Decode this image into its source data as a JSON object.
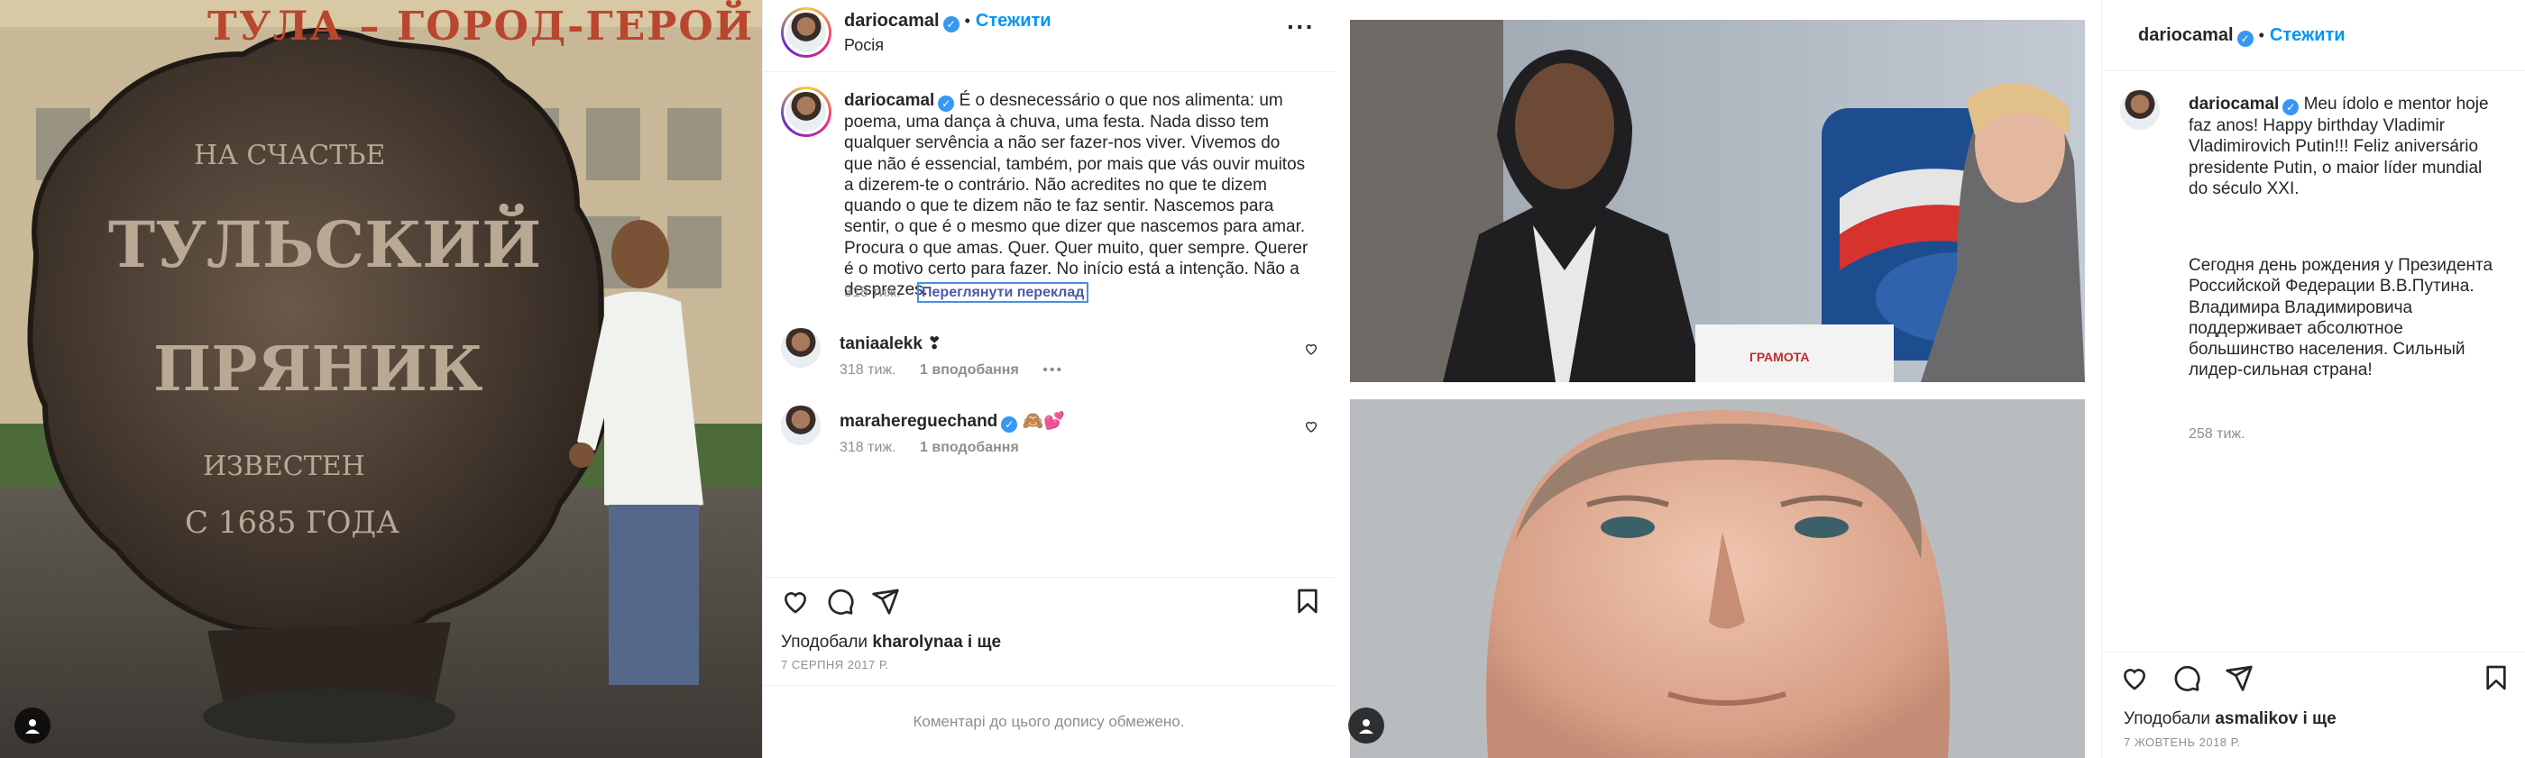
{
  "post1": {
    "photo_banner": "ТУЛА – ГОРОД-ГЕРОЙ",
    "gingerbread_text": [
      "НА СЧАСТЬЕ",
      "ТУЛЬСКИЙ",
      "ПРЯНИК",
      "ИЗВЕСТЕН",
      "С 1685 ГОДА"
    ],
    "username": "dariocamal",
    "follow_label": "Стежити",
    "location": "Росія",
    "caption": "É o desnecessário o que nos alimenta: um poema, uma dança à chuva, uma festa. Nada disso tem qualquer servência a não ser fazer-nos viver. Vivemos do que não é essencial, também, por mais que vás ouvir muitos a dizerem-te o contrário. Não acredites no que te dizem quando o que te dizem não te faz sentir. Nascemos para sentir, o que é o mesmo que dizer que nascemos para amar. Procura o que amas. Quer. Quer muito, quer sempre. Querer é o motivo certo para fazer. No início está a intenção. Não a desprezes.",
    "caption_time": "318 тиж.",
    "translate_label": "Переглянути переклад",
    "comments": [
      {
        "user": "taniaalekk",
        "text": "❣",
        "time": "318 тиж.",
        "replies": "1 вподобання",
        "more": "•••"
      },
      {
        "user": "marahereguechand",
        "text": "🙈💕",
        "time": "318 тиж.",
        "replies": "1 вподобання"
      }
    ],
    "liked_by_prefix": "Уподобали",
    "liked_by_user": "kharolynaa",
    "liked_by_suffix": "і ще",
    "date": "7 СЕРПНЯ 2017 Р.",
    "comments_limited": "Коментарі до цього допису обмежено."
  },
  "post2": {
    "photo_top_label": "ГРАМОТА",
    "username": "dariocamal",
    "follow_label": "Стежити",
    "caption": "Meu ídolo e mentor hoje faz anos! Happy birthday Vladimir Vladimirovich Putin!!! Feliz aniversário presidente Putin, o maior líder mundial do século XXI.",
    "caption_ru": "Сегодня день рождения у Президента Российской Федерации В.В.Путина. Владимира Владимировича поддерживает абсолютное большинство населения. Сильный лидер-сильная страна!",
    "caption_time": "258 тиж.",
    "liked_by_prefix": "Уподобали",
    "liked_by_user": "asmalikov",
    "liked_by_suffix": "і ще",
    "date": "7 ЖОВТЕНЬ 2018 Р."
  },
  "icons": [
    "user-tag-icon",
    "verified-badge-icon",
    "more-options-icon",
    "heart-icon",
    "comment-icon",
    "share-icon",
    "bookmark-icon"
  ],
  "colors": {
    "link": "#0095f6",
    "verified": "#3897f0",
    "muted": "#8e8e8e",
    "border": "#efefef"
  }
}
